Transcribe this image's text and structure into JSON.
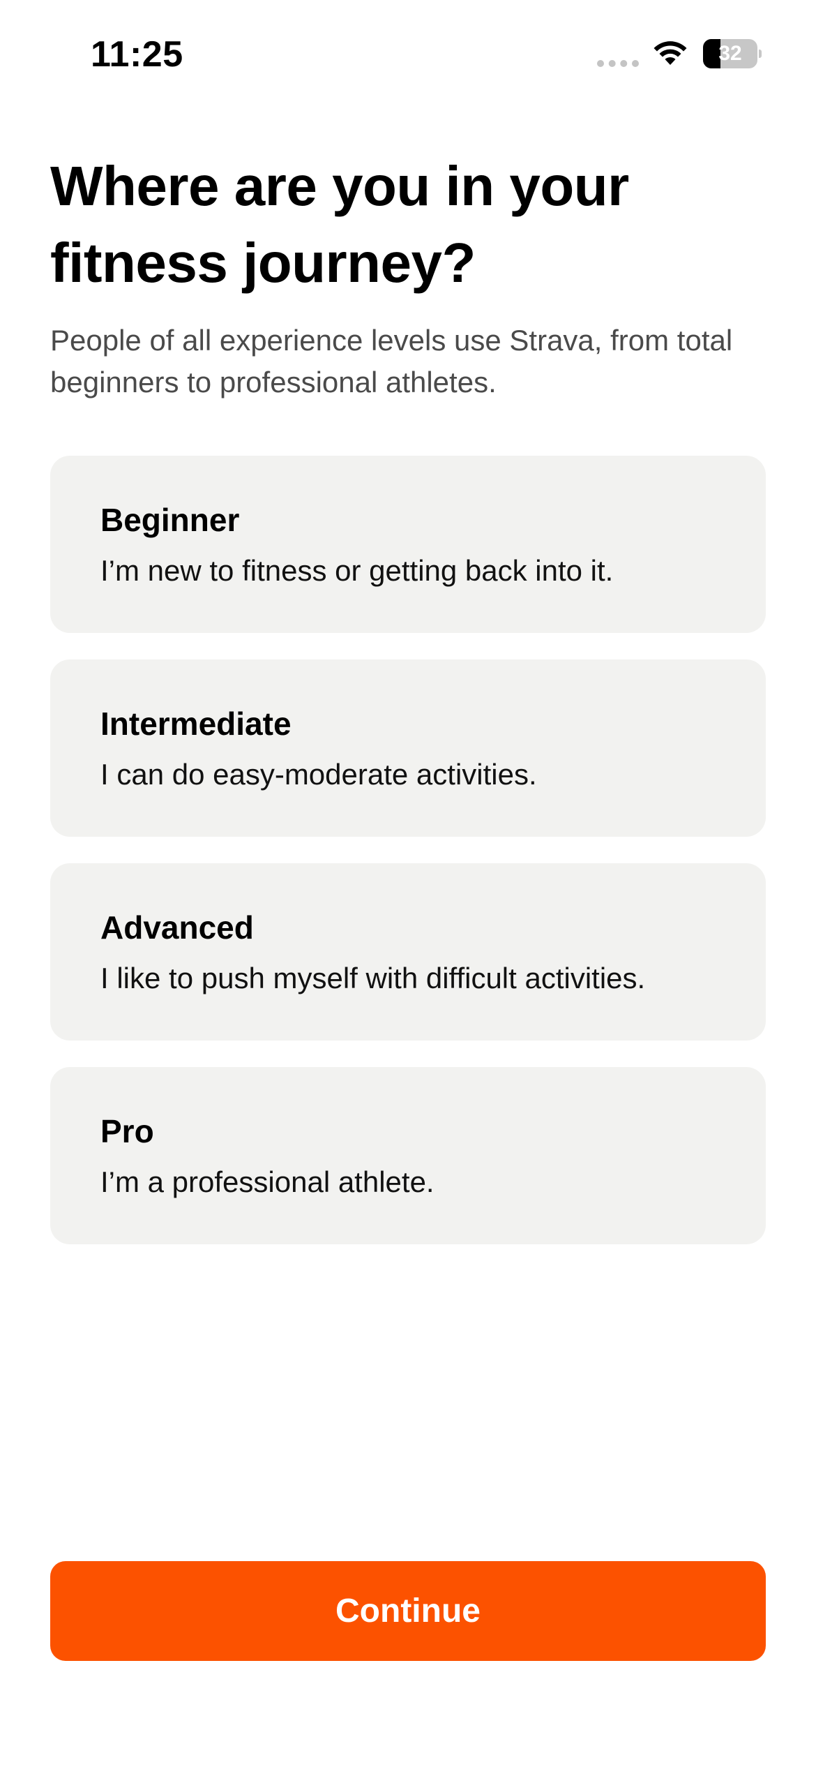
{
  "status_bar": {
    "time": "11:25",
    "battery_level": "32",
    "battery_fraction": 0.32,
    "icons": [
      "cellular-signal-icon",
      "wifi-icon",
      "battery-icon"
    ]
  },
  "header": {
    "title": "Where are you in your fitness journey?",
    "subtitle": "People of all experience levels use Strava, from total beginners to professional athletes."
  },
  "options": [
    {
      "title": "Beginner",
      "description": "I’m new to fitness or getting back into it."
    },
    {
      "title": "Intermediate",
      "description": "I can do easy-moderate activities."
    },
    {
      "title": "Advanced",
      "description": "I like to push myself with difficult activities."
    },
    {
      "title": "Pro",
      "description": "I’m a professional athlete."
    }
  ],
  "footer": {
    "continue_label": "Continue"
  },
  "colors": {
    "accent": "#fc5200",
    "card_background": "#f2f2f0",
    "subtitle_text": "#4a4a4a"
  }
}
